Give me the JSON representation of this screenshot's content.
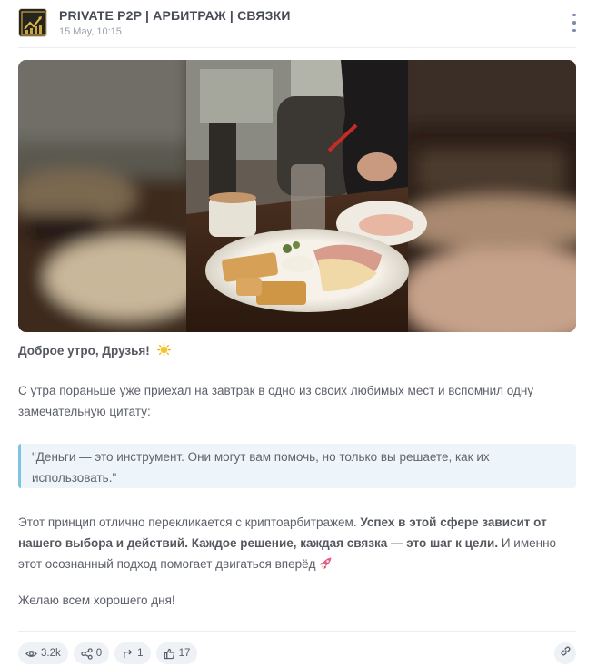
{
  "channel": {
    "title": "PRIVATE P2P | АРБИТРАЖ | СВЯЗКИ",
    "date": "15 May, 10:15"
  },
  "post": {
    "greeting": "Доброе утро, Друзья!",
    "greeting_emoji": "sun",
    "intro": "С утра пораньше уже приехал на завтрак в одно из своих любимых мест и вспомнил одну замечательную цитату:",
    "quote": "\"Деньги — это инструмент. Они могут вам помочь, но только вы решаете, как их использовать.\"",
    "body_start": "Этот принцип отлично перекликается с криптоарбитражем. ",
    "body_bold": "Успех в этой сфере зависит от нашего выбора и действий. Каждое решение, каждая связка — это шаг к цели.",
    "body_end": " И именно этот осознанный подход помогает двигаться вперёд",
    "body_emoji": "rocket",
    "closing": "Желаю всем хорошего дня!"
  },
  "stats": {
    "views": "3.2k",
    "shares": "0",
    "forwards": "1",
    "likes": "17"
  },
  "icons": {
    "views": "eye-icon",
    "shares": "share-icon",
    "forwards": "forward-icon",
    "likes": "thumbs-up-icon",
    "link": "link-icon",
    "more": "more-vertical-icon"
  },
  "colors": {
    "accent": "#7ec3e0",
    "pill_bg": "#eef1f5",
    "title_text": "#474b55"
  }
}
